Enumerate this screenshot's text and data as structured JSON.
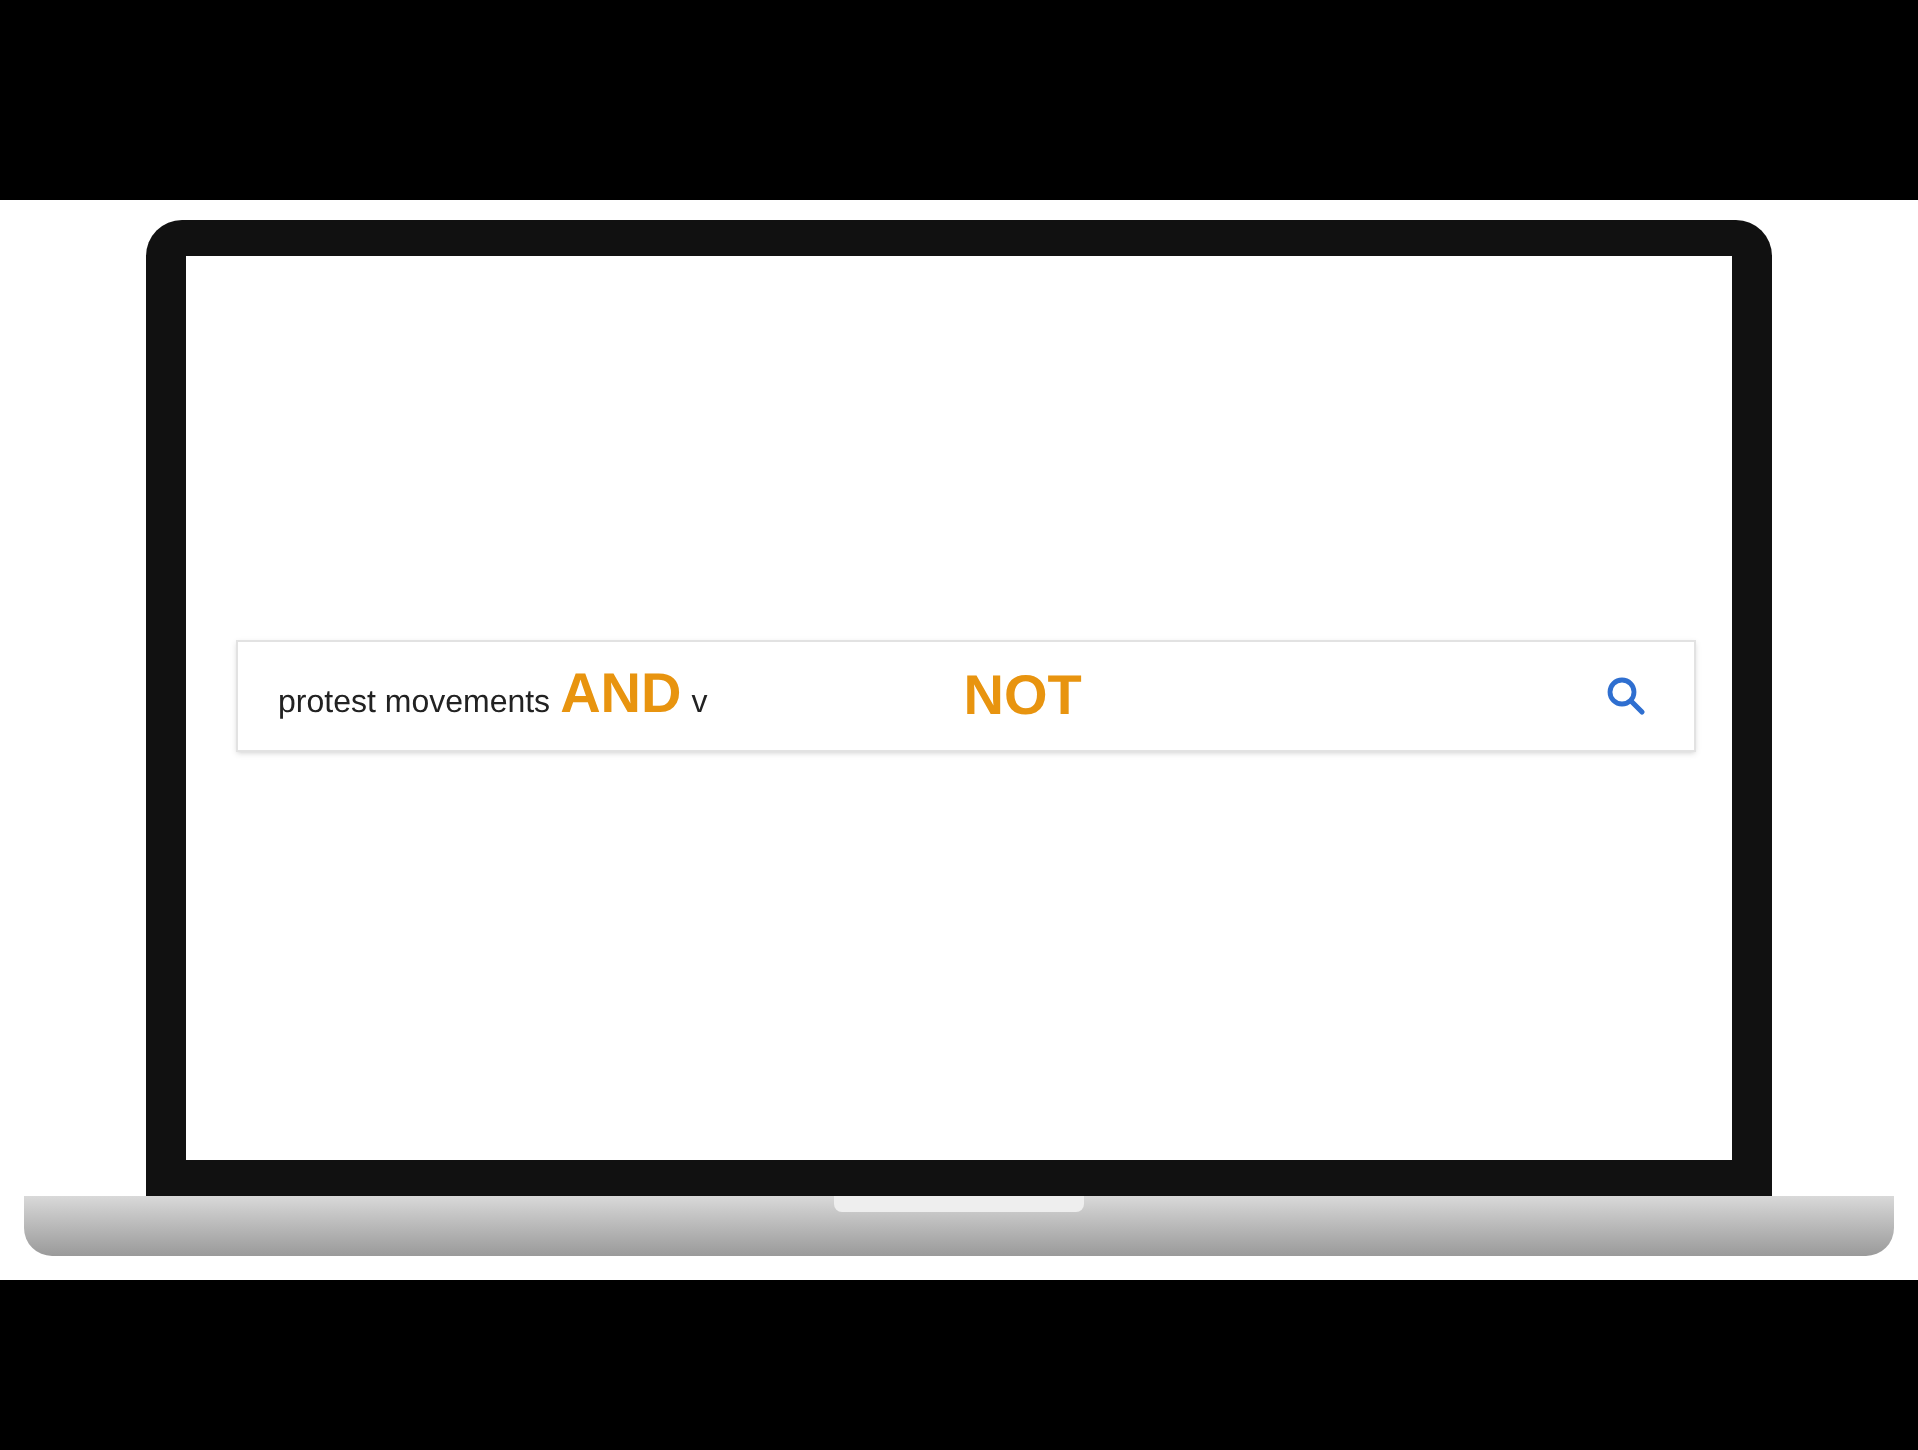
{
  "search": {
    "terms": [
      {
        "text": "protest movements",
        "kind": "term"
      },
      {
        "text": "AND",
        "kind": "operator"
      },
      {
        "text": "v",
        "kind": "term"
      }
    ],
    "floating_operator": "NOT"
  }
}
